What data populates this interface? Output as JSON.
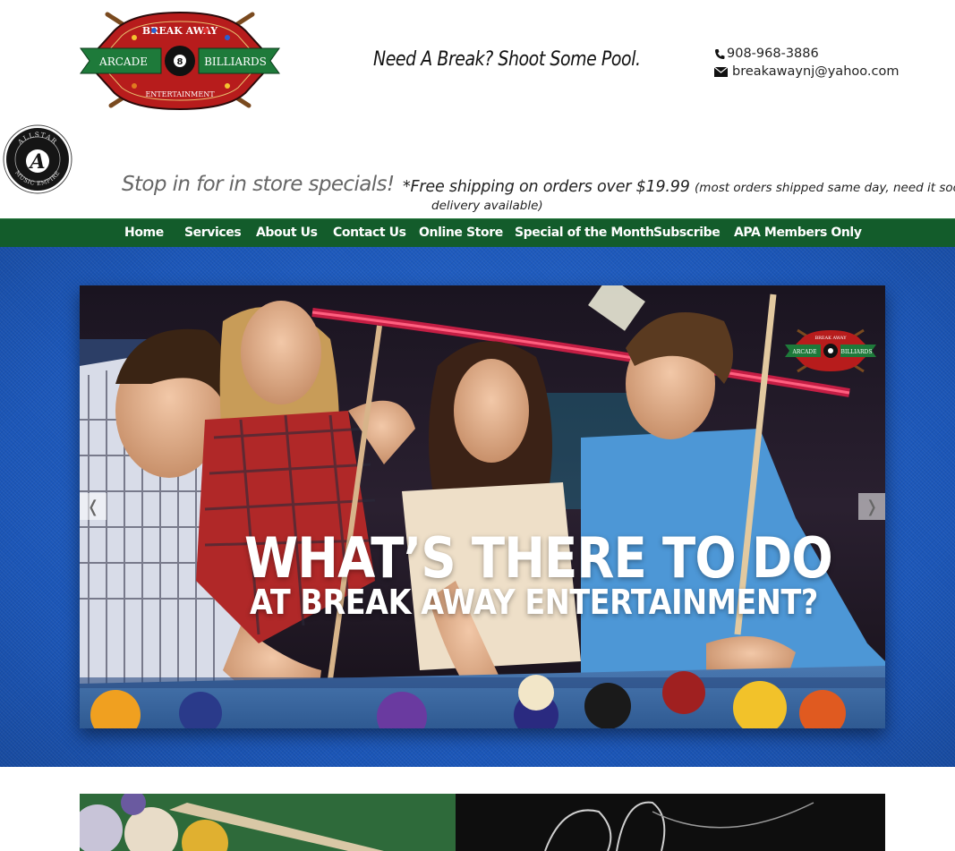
{
  "header": {
    "logo": {
      "top_text": "BREAK AWAY",
      "left_text": "ARCADE",
      "right_text": "BILLIARDS",
      "bottom_text": "ENTERTAINMENT",
      "ball_number": "8"
    },
    "tagline": "Need A Break? Shoot Some Pool.",
    "phone": "908-968-3886",
    "email": "breakawaynj@yahoo.com",
    "badge": {
      "top_text": "ALLSTAR",
      "bottom_text": "MUSIC EMPIRE",
      "letter": "A"
    },
    "specials": "Stop in for in store specials!",
    "shipping_main": "*Free shipping on orders over $19.99",
    "shipping_note": "(most orders shipped same day, need it soon, loca",
    "shipping_line2": "delivery available)"
  },
  "nav": {
    "items": [
      {
        "label": "Home"
      },
      {
        "label": "Services"
      },
      {
        "label": "About Us"
      },
      {
        "label": "Contact Us"
      },
      {
        "label": "Online Store"
      },
      {
        "label": "Special of the Month"
      },
      {
        "label": "Subscribe"
      },
      {
        "label": "APA Members Only"
      }
    ]
  },
  "hero": {
    "heading": "WHAT’S THERE TO DO",
    "subheading": "AT BREAK AWAY ENTERTAINMENT?",
    "prev_label": "❬",
    "next_label": "❭",
    "slide_logo": {
      "top_text": "BREAK AWAY",
      "left_text": "ARCADE",
      "right_text": "BILLIARDS"
    }
  },
  "colors": {
    "nav_green": "#135c2b",
    "felt_blue": "#1f5fc4",
    "logo_red": "#b71c1c",
    "logo_green": "#1e7a3a"
  },
  "icons": {
    "phone": "phone-icon",
    "email": "envelope-icon",
    "prev": "chevron-left-icon",
    "next": "chevron-right-icon"
  }
}
